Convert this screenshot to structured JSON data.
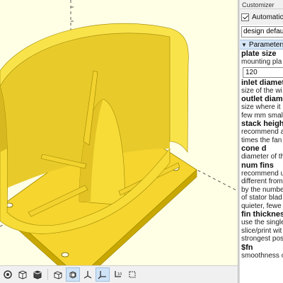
{
  "app": {
    "panel_title": "Customizer"
  },
  "customizer": {
    "auto_preview_label": "Automatic P",
    "auto_preview_checked": true,
    "preset_value": "design defaul",
    "group_label": "Parameters",
    "params": [
      {
        "name": "plate size",
        "desc": [
          "mounting pla"
        ],
        "value": "120"
      },
      {
        "name": "inlet diamet",
        "desc": [
          "size of the wi"
        ]
      },
      {
        "name": "outlet diam",
        "desc": [
          "size where it",
          "few mm smal"
        ]
      },
      {
        "name": "stack heigh",
        "desc": [
          "recommend a",
          "times the fan"
        ]
      },
      {
        "name": "cone d",
        "desc": [
          "diameter of th"
        ]
      },
      {
        "name": "num fins",
        "desc": [
          "recommend u",
          "different from",
          "by the numbe",
          "of stator blad",
          "quieter, fewe"
        ]
      },
      {
        "name": "fin thicknes",
        "desc": [
          "use the single",
          "slice/print wit",
          "strongest pos"
        ]
      },
      {
        "name": "$fn",
        "desc": [
          "smoothness o"
        ]
      }
    ]
  },
  "colors": {
    "viewport_bg": "#ffffe5",
    "model_fill": "#f9e34a",
    "model_edge": "#9a8400",
    "panel_header_bg": "#d6e6f6"
  },
  "toolbar": {
    "buttons": [
      "view-right-icon",
      "view-top-icon",
      "view-bottom-icon",
      "view-diagonal-icon",
      "view-center-icon",
      "perspective-icon",
      "orthogonal-icon",
      "show-axes-icon",
      "show-scale-markers-icon",
      "show-edges-icon"
    ]
  }
}
